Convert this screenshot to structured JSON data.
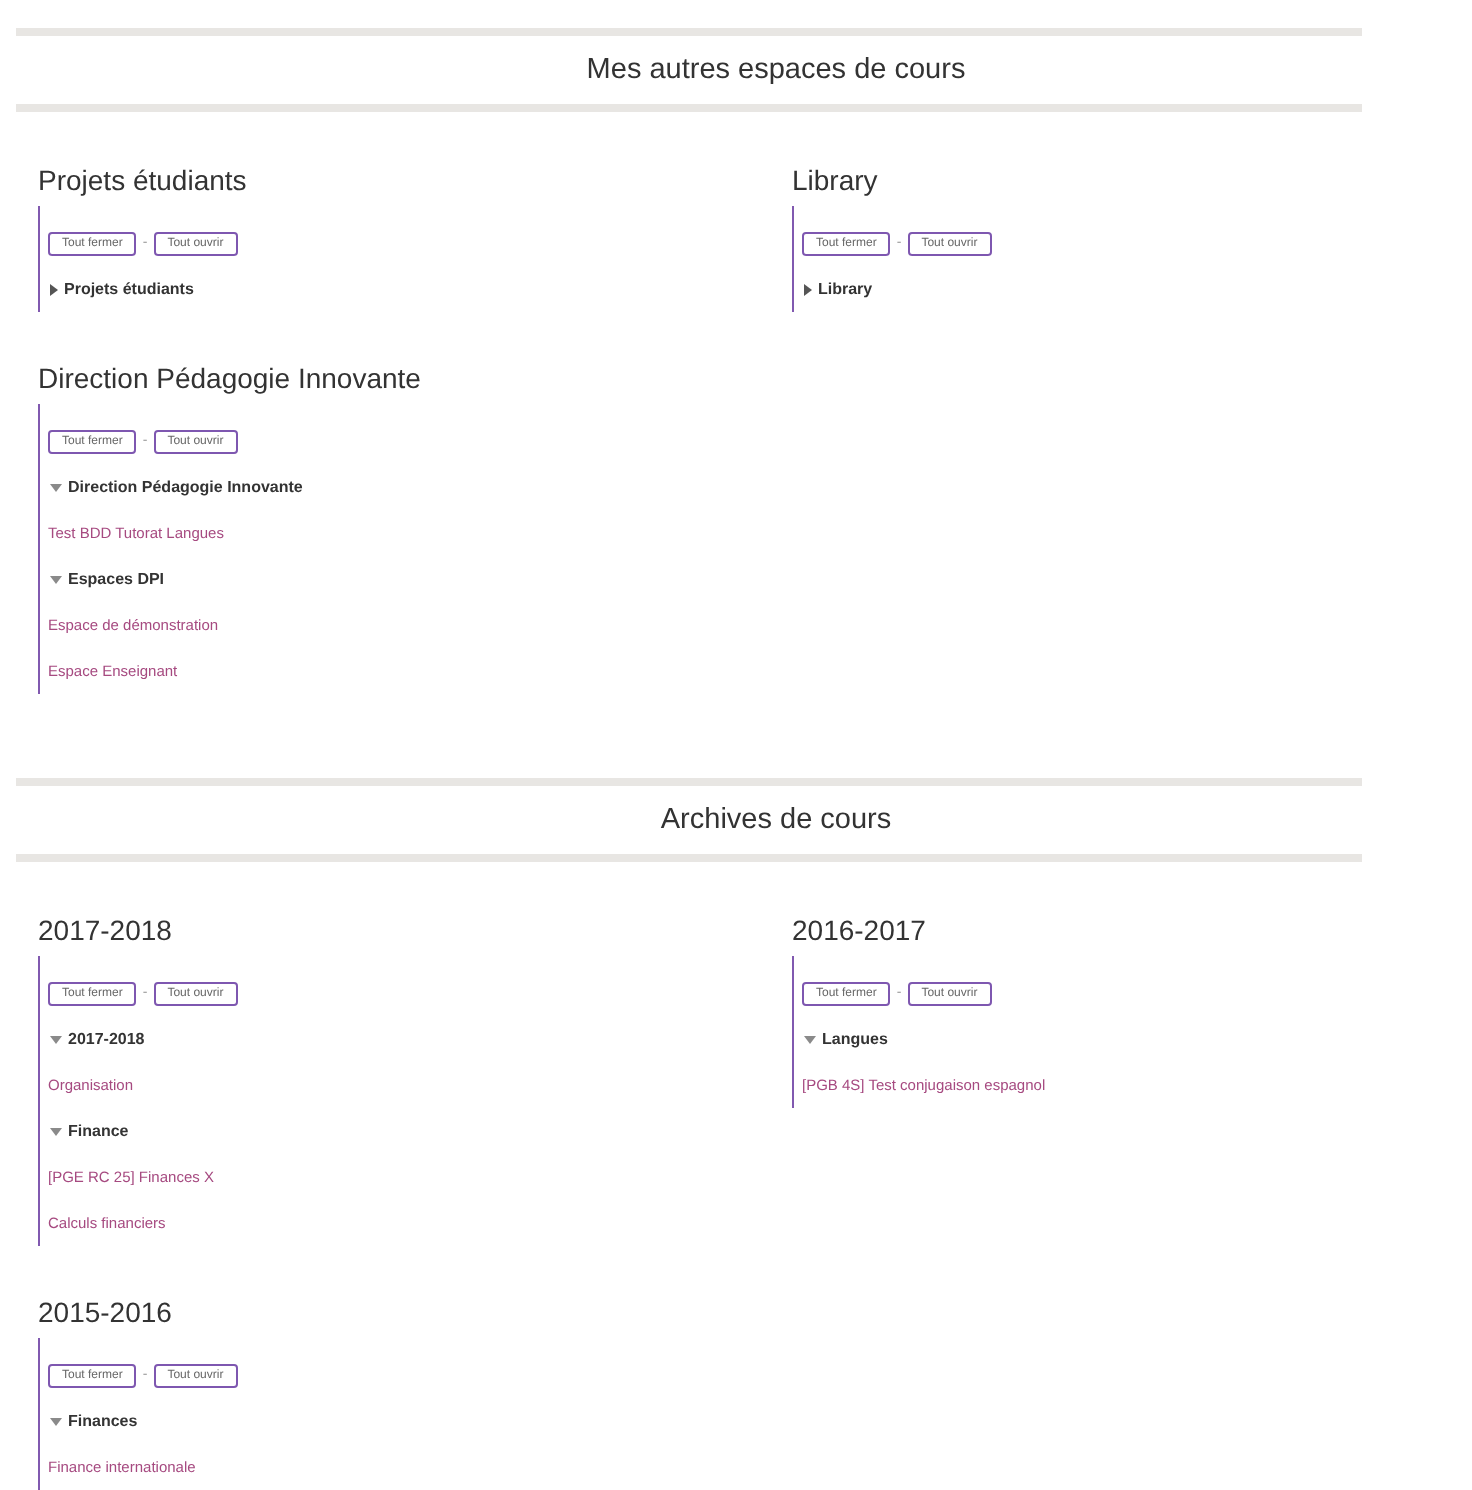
{
  "sections": [
    {
      "title": "Mes autres espaces de cours",
      "categories": [
        {
          "title": "Projets étudiants",
          "buttons": [
            "Tout fermer",
            "Tout ouvrir"
          ],
          "separator": "-",
          "tree": [
            {
              "kind": "category",
              "label": "Projets étudiants",
              "expanded": false
            }
          ]
        },
        {
          "title": "Library",
          "buttons": [
            "Tout fermer",
            "Tout ouvrir"
          ],
          "separator": "-",
          "tree": [
            {
              "kind": "category",
              "label": "Library",
              "expanded": false
            }
          ]
        },
        {
          "title": "Direction Pédagogie Innovante",
          "buttons": [
            "Tout fermer",
            "Tout ouvrir"
          ],
          "separator": "-",
          "tree": [
            {
              "kind": "category",
              "label": "Direction Pédagogie Innovante",
              "expanded": true,
              "children": [
                {
                  "kind": "link",
                  "label": "Test BDD Tutorat Langues"
                },
                {
                  "kind": "category",
                  "label": "Espaces DPI",
                  "expanded": true,
                  "children": [
                    {
                      "kind": "link",
                      "label": "Espace de démonstration"
                    },
                    {
                      "kind": "link",
                      "label": "Espace Enseignant"
                    }
                  ]
                }
              ]
            }
          ]
        }
      ]
    },
    {
      "title": "Archives de cours",
      "categories": [
        {
          "title": "2017-2018",
          "buttons": [
            "Tout fermer",
            "Tout ouvrir"
          ],
          "separator": "-",
          "tree": [
            {
              "kind": "category",
              "label": "2017-2018",
              "expanded": true,
              "children": [
                {
                  "kind": "link",
                  "label": "Organisation"
                },
                {
                  "kind": "category",
                  "label": "Finance",
                  "expanded": true,
                  "children": [
                    {
                      "kind": "link",
                      "label": "[PGE RC 25] Finances X"
                    },
                    {
                      "kind": "link",
                      "label": "Calculs financiers"
                    }
                  ]
                }
              ]
            }
          ]
        },
        {
          "title": "2016-2017",
          "buttons": [
            "Tout fermer",
            "Tout ouvrir"
          ],
          "separator": "-",
          "tree": [
            {
              "kind": "category",
              "label": "Langues",
              "expanded": true,
              "children": [
                {
                  "kind": "link",
                  "label": "[PGB 4S] Test conjugaison espagnol"
                }
              ]
            }
          ]
        },
        {
          "title": "2015-2016",
          "buttons": [
            "Tout fermer",
            "Tout ouvrir"
          ],
          "separator": "-",
          "tree": [
            {
              "kind": "category",
              "label": "Finances",
              "expanded": true,
              "children": [
                {
                  "kind": "link",
                  "label": "Finance internationale"
                }
              ]
            }
          ]
        }
      ]
    }
  ]
}
